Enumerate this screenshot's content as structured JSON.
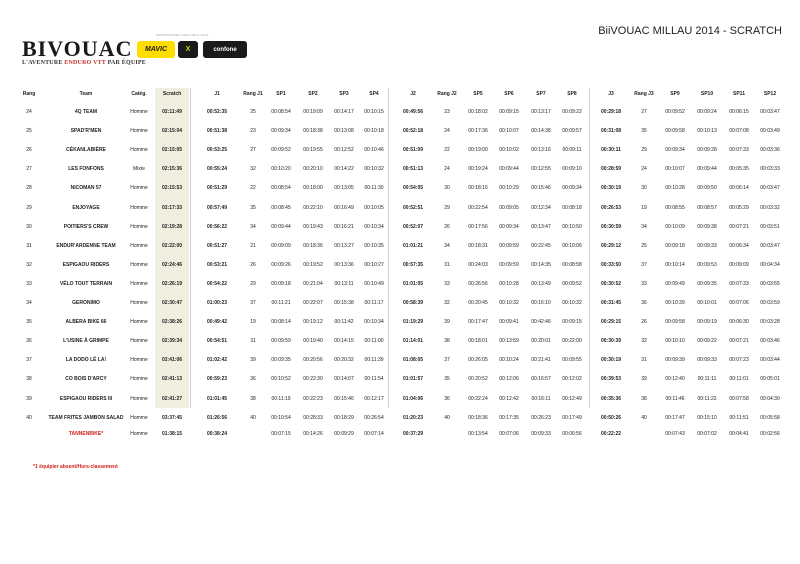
{
  "header": {
    "logo_main": "BIVOUAC",
    "logo_sub_pre": "L'AVENTURE ",
    "logo_sub_red": "ENDURO VTT",
    "logo_sub_post": " PAR ÉQUIPE",
    "partners_label": "PARTENAIRES OFFICIELS 2014",
    "sponsors": [
      "MAVIC",
      "X",
      "confone"
    ],
    "title": "BiiVOUAC MILLAU 2014 - SCRATCH"
  },
  "table": {
    "columns": [
      "Rang",
      "Team",
      "Catég.",
      "Scratch",
      "J1",
      "Rang J1",
      "SP1",
      "SP2",
      "SP3",
      "SP4",
      "J2",
      "Rang J2",
      "SP5",
      "SP6",
      "SP7",
      "SP8",
      "J3",
      "Rang J3",
      "SP9",
      "SP10",
      "SP11",
      "SP12"
    ],
    "rows": [
      [
        "24",
        "4Q TEAM",
        "Homme",
        "02:11:49",
        "00:52:35",
        "25",
        "00:08:54",
        "00:19:09",
        "00:14:17",
        "00:10:15",
        "00:49:56",
        "23",
        "00:18:02",
        "00:09:15",
        "00:13:17",
        "00:09:22",
        "00:29:18",
        "27",
        "00:09:52",
        "00:09:24",
        "00:06:15",
        "00:03:47"
      ],
      [
        "25",
        "SPAD'R'MEN",
        "Homme",
        "02:15:04",
        "00:51:38",
        "23",
        "00:09:34",
        "00:18:38",
        "00:13:08",
        "00:10:18",
        "00:52:18",
        "24",
        "00:17:36",
        "00:10:07",
        "00:14:38",
        "00:09:57",
        "00:31:08",
        "35",
        "00:09:58",
        "00:10:13",
        "00:07:08",
        "00:03:49"
      ],
      [
        "26",
        "CÉKANLABIÈRE",
        "Homme",
        "02:15:05",
        "00:53:25",
        "27",
        "00:09:52",
        "00:19:55",
        "00:12:52",
        "00:10:46",
        "00:51:09",
        "22",
        "00:19:00",
        "00:10:02",
        "00:13:16",
        "00:09:11",
        "00:30:11",
        "29",
        "00:09:34",
        "00:09:28",
        "00:07:33",
        "00:03:36"
      ],
      [
        "27",
        "LES FONFONS",
        "Mixte",
        "02:15:36",
        "00:55:24",
        "32",
        "00:10:20",
        "00:20:10",
        "00:14:22",
        "00:10:32",
        "00:51:13",
        "24",
        "00:19:24",
        "00:09:44",
        "00:12:55",
        "00:09:10",
        "00:28:59",
        "24",
        "00:10:07",
        "00:09:44",
        "00:05:35",
        "00:03:33"
      ],
      [
        "28",
        "NICOMAN 57",
        "Homme",
        "02:15:53",
        "00:51:29",
        "22",
        "00:08:54",
        "00:18:00",
        "00:13:05",
        "00:11:30",
        "00:54:05",
        "30",
        "00:18:16",
        "00:10:29",
        "00:15:46",
        "00:09:34",
        "00:30:19",
        "30",
        "00:10:28",
        "00:09:50",
        "00:06:14",
        "00:03:47"
      ],
      [
        "29",
        "ENJOYAGE",
        "Homme",
        "02:17:33",
        "00:57:49",
        "35",
        "00:08:45",
        "00:22:10",
        "00:16:49",
        "00:10:05",
        "00:52:51",
        "29",
        "00:22:54",
        "00:09:05",
        "00:12:34",
        "00:08:18",
        "00:26:53",
        "19",
        "00:08:55",
        "00:08:57",
        "00:05:29",
        "00:03:32"
      ],
      [
        "30",
        "POITIERS'S CREW",
        "Homme",
        "02:19:28",
        "00:56:22",
        "34",
        "00:09:44",
        "00:19:43",
        "00:16:21",
        "00:10:34",
        "00:52:07",
        "26",
        "00:17:56",
        "00:09:34",
        "00:13:47",
        "00:10:50",
        "00:30:59",
        "34",
        "00:10:09",
        "00:09:38",
        "00:07:21",
        "00:03:51"
      ],
      [
        "31",
        "ENDUR'ARDENNE TEAM",
        "Homme",
        "02:22:00",
        "00:51:27",
        "21",
        "00:09:09",
        "00:18:36",
        "00:13:27",
        "00:10:35",
        "01:01:21",
        "34",
        "00:18:31",
        "00:09:59",
        "00:22:45",
        "00:10:06",
        "00:29:12",
        "25",
        "00:09:18",
        "00:09:33",
        "00:06:34",
        "00:03:47"
      ],
      [
        "32",
        "ESPIGAOU RIDERS",
        "Homme",
        "02:24:46",
        "00:53:21",
        "26",
        "00:09:26",
        "00:19:52",
        "00:13:36",
        "00:10:27",
        "00:57:35",
        "31",
        "00:24:03",
        "00:09:59",
        "00:14:35",
        "00:08:58",
        "00:33:50",
        "37",
        "00:10:14",
        "00:09:53",
        "00:09:09",
        "00:04:34"
      ],
      [
        "33",
        "VÉLO TOUT TERRAIN",
        "Homme",
        "02:26:19",
        "00:54:22",
        "29",
        "00:09:18",
        "00:21:04",
        "00:13:11",
        "00:10:49",
        "01:01:05",
        "33",
        "00:26:56",
        "00:10:28",
        "00:13:49",
        "00:09:52",
        "00:30:52",
        "33",
        "00:09:49",
        "00:09:35",
        "00:07:33",
        "00:03:55"
      ],
      [
        "34",
        "GERONIMO",
        "Homme",
        "02:30:47",
        "01:00:23",
        "37",
        "00:11:21",
        "00:22:07",
        "00:15:38",
        "00:11:17",
        "00:58:39",
        "32",
        "00:20:45",
        "00:10:32",
        "00:16:10",
        "00:10:32",
        "00:31:45",
        "36",
        "00:10:39",
        "00:10:01",
        "00:07:06",
        "00:03:59"
      ],
      [
        "35",
        "ALBERA BIKE 66",
        "Homme",
        "02:38:26",
        "00:49:42",
        "19",
        "00:08:14",
        "00:19:12",
        "00:11:42",
        "00:10:34",
        "01:19:29",
        "39",
        "00:17:47",
        "00:09:41",
        "00:42:46",
        "00:09:15",
        "00:29:15",
        "26",
        "00:09:58",
        "00:09:19",
        "00:06:30",
        "00:03:28"
      ],
      [
        "36",
        "L'USINE À GRIMPE",
        "Homme",
        "02:39:34",
        "00:54:51",
        "31",
        "00:09:59",
        "00:19:40",
        "00:14:15",
        "00:11:00",
        "01:14:01",
        "38",
        "00:18:01",
        "00:13:59",
        "00:20:01",
        "00:22:00",
        "00:30:39",
        "32",
        "00:10:10",
        "00:09:22",
        "00:07:21",
        "00:03:46"
      ],
      [
        "37",
        "LA DODO LÉ LA!",
        "Homme",
        "02:41:06",
        "01:02:42",
        "39",
        "00:09:35",
        "00:20:56",
        "00:20:32",
        "00:11:39",
        "01:08:05",
        "37",
        "00:26:05",
        "00:10:24",
        "00:21:41",
        "00:09:55",
        "00:30:19",
        "31",
        "00:09:39",
        "00:09:33",
        "00:07:23",
        "00:03:44"
      ],
      [
        "38",
        "CO BOIS D'ARCY",
        "Homme",
        "02:41:13",
        "00:59:23",
        "36",
        "00:10:52",
        "00:22:30",
        "00:14:07",
        "00:11:54",
        "01:01:57",
        "35",
        "00:20:52",
        "00:12:06",
        "00:16:57",
        "00:12:02",
        "00:39:53",
        "39",
        "00:12:40",
        "00:11:11",
        "00:11:01",
        "00:05:01"
      ],
      [
        "39",
        "ESPIGAOU RIDERS III",
        "Homme",
        "02:41:27",
        "01:01:45",
        "38",
        "00:11:19",
        "00:22:23",
        "00:15:46",
        "00:12:17",
        "01:04:06",
        "36",
        "00:22:24",
        "00:12:42",
        "00:16:11",
        "00:12:49",
        "00:35:36",
        "38",
        "00:11:46",
        "00:11:22",
        "00:07:58",
        "00:04:30"
      ],
      [
        "40",
        "TEAM FRITES JAMBON SALAD",
        "Homme",
        "03:37:45",
        "01:26:56",
        "40",
        "00:10:54",
        "00:28:33",
        "00:18:29",
        "00:26:54",
        "01:20:23",
        "40",
        "00:18:36",
        "00:17:35",
        "00:26:23",
        "00:17:49",
        "00:50:26",
        "40",
        "00:17:47",
        "00:15:10",
        "00:11:51",
        "00:05:58"
      ]
    ],
    "special_row": [
      "",
      "TANNENBIKE*",
      "Homme",
      "01:38:15",
      "00:38:24",
      "",
      "00:07:15",
      "00:14:26",
      "00:09:29",
      "00:07:14",
      "00:37:29",
      "",
      "00:13:54",
      "00:07:06",
      "00:09:33",
      "00:06:56",
      "00:22:22",
      "",
      "00:07:43",
      "00:07:02",
      "00:04:41",
      "00:02:56"
    ],
    "colors": {
      "scratch_band": "#efeedf",
      "special_text": "#d0201a"
    }
  },
  "footnote": "*1 équipier absent/Hors-classement"
}
